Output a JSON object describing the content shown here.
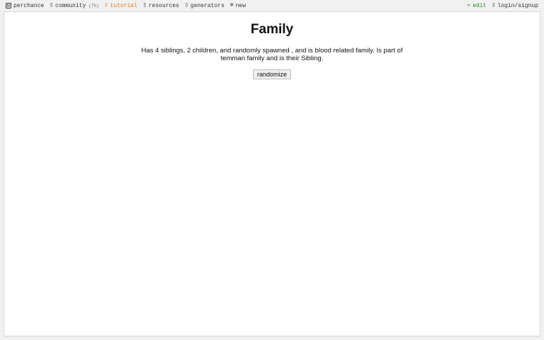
{
  "nav": {
    "brand": "perchance",
    "community": "community",
    "community_count": "(7h)",
    "tutorial": "tutorial",
    "resources": "resources",
    "generators": "generators",
    "new": "new",
    "edit": "edit",
    "login": "login/signup"
  },
  "icons": {
    "community": "chat-icon",
    "tutorial": "book-icon",
    "resources": "folder-icon",
    "generators": "list-icon",
    "new": "plus-circle-icon",
    "edit": "pencil-icon",
    "login": "user-icon"
  },
  "colors": {
    "tutorial": "#e07a1a",
    "edit": "#2d8a2d"
  },
  "main": {
    "title": "Family",
    "description": "Has 4 siblings, 2 children, and randomly spawned , and is blood related family. Is part of temman family and is their Sibling.",
    "randomize_label": "randomize"
  }
}
